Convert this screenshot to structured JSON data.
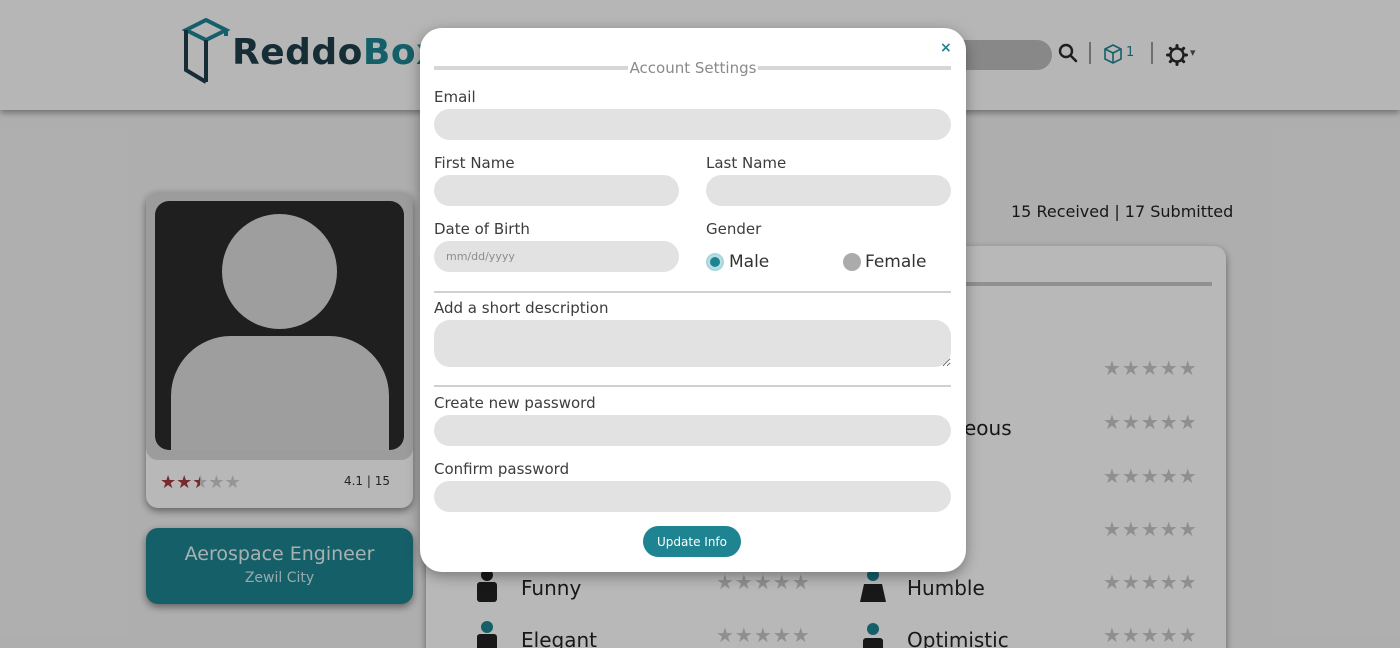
{
  "brand": {
    "name_part1": "Reddo",
    "name_part2": "Box"
  },
  "nav": {
    "box_count": "1",
    "caret": "▾"
  },
  "profile": {
    "rating_text": "4.1 | 15",
    "job_title": "Aerospace Engineer",
    "job_location": "Zewil City"
  },
  "stats": {
    "text": "15 Received | 17 Submitted"
  },
  "traits": {
    "stars": "★★★★★",
    "visible_partial_label": "eous",
    "items": [
      {
        "label": "Funny"
      },
      {
        "label": "Humble"
      },
      {
        "label": "Elegant"
      },
      {
        "label": "Optimistic"
      }
    ]
  },
  "modal": {
    "close": "×",
    "title": "Account Settings",
    "email_label": "Email",
    "first_name_label": "First Name",
    "last_name_label": "Last Name",
    "dob_label": "Date of Birth",
    "dob_placeholder": "mm/dd/yyyy",
    "gender_label": "Gender",
    "gender_options": [
      "Male",
      "Female"
    ],
    "gender_selected": "Male",
    "description_label": "Add a short description",
    "new_password_label": "Create new password",
    "confirm_password_label": "Confirm password",
    "submit_label": "Update Info"
  },
  "colors": {
    "accent": "#1e8492",
    "dark": "#1f3f4c",
    "star_red": "#a83b3b"
  }
}
